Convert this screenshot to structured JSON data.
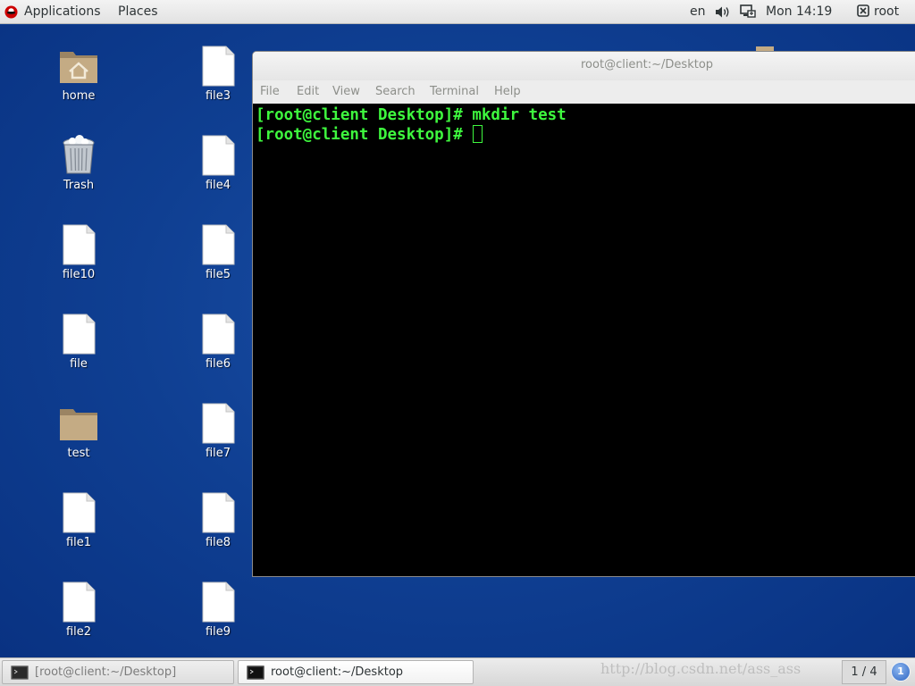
{
  "top_panel": {
    "applications": "Applications",
    "places": "Places",
    "language": "en",
    "clock": "Mon 14:19",
    "user": "root"
  },
  "desktop_icons": {
    "home": "home",
    "trash": "Trash",
    "file10": "file10",
    "file": "file",
    "test": "test",
    "file1": "file1",
    "file2": "file2",
    "file3": "file3",
    "file4": "file4",
    "file5": "file5",
    "file6": "file6",
    "file7": "file7",
    "file8": "file8",
    "file9": "file9"
  },
  "terminal": {
    "title": "root@client:~/Desktop",
    "menu": [
      "File",
      "Edit",
      "View",
      "Search",
      "Terminal",
      "Help"
    ],
    "lines": [
      "[root@client Desktop]# mkdir test",
      "[root@client Desktop]# "
    ]
  },
  "bottom_panel": {
    "tasks": [
      "[root@client:~/Desktop]",
      "root@client:~/Desktop"
    ],
    "watermark": "http://blog.csdn.net/ass_ass",
    "workspace": "1 / 4",
    "notifications": "1"
  },
  "colors": {
    "desktop_bg": "#0c3c8e",
    "terminal_text": "#3ef83e",
    "terminal_bg": "#000000"
  }
}
